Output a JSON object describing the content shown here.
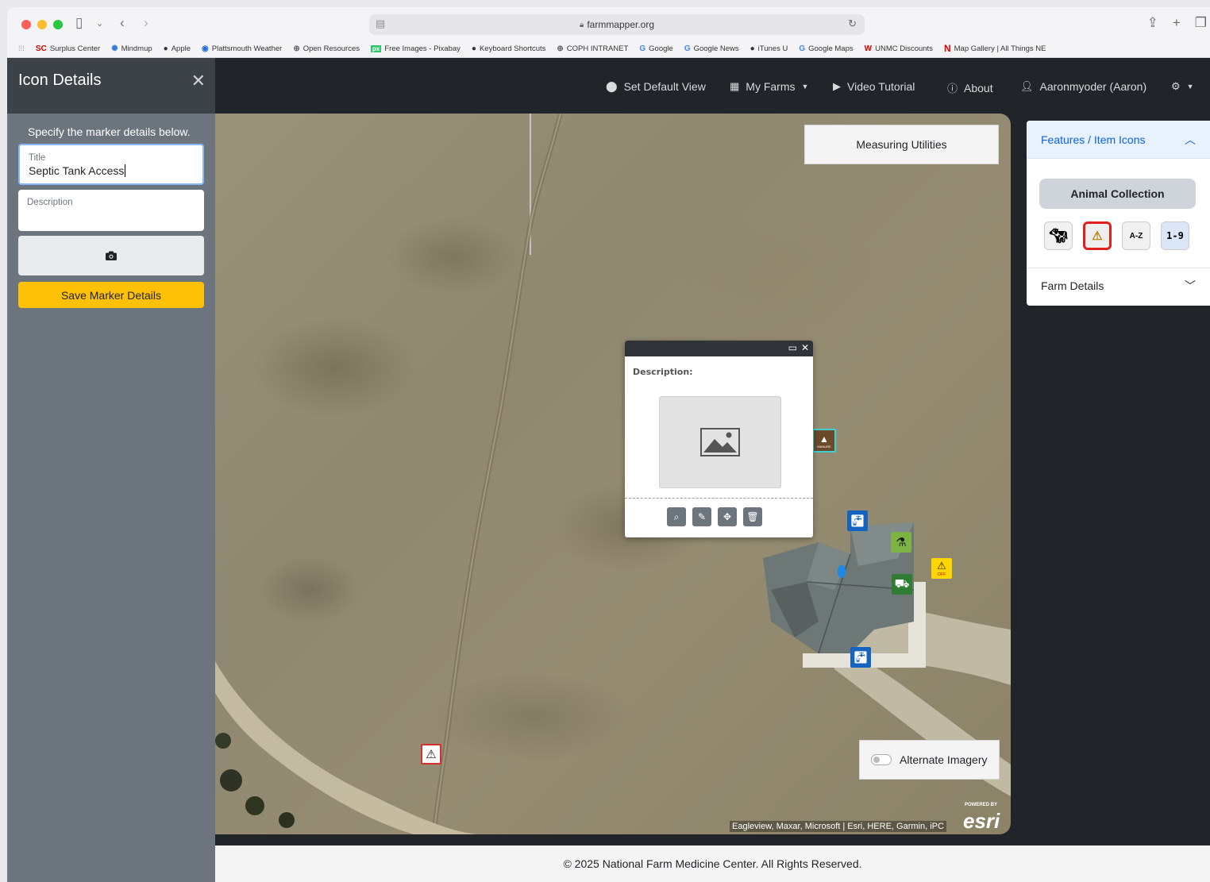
{
  "browser": {
    "url": "farmmapper.org",
    "bookmarks": [
      {
        "label": "Surplus Center",
        "icon": "sc-logo"
      },
      {
        "label": "Mindmup",
        "icon": "mindmup-icon"
      },
      {
        "label": "Apple",
        "icon": "apple-icon"
      },
      {
        "label": "Plattsmouth Weather",
        "icon": "weather-icon"
      },
      {
        "label": "Open Resources",
        "icon": "globe-icon"
      },
      {
        "label": "Free Images - Pixabay",
        "icon": "pixabay-icon"
      },
      {
        "label": "Keyboard Shortcuts",
        "icon": "apple-icon"
      },
      {
        "label": "COPH INTRANET",
        "icon": "globe-icon"
      },
      {
        "label": "Google",
        "icon": "google-icon"
      },
      {
        "label": "Google News",
        "icon": "google-icon"
      },
      {
        "label": "iTunes U",
        "icon": "apple-icon"
      },
      {
        "label": "Google Maps",
        "icon": "google-icon"
      },
      {
        "label": "UNMC Discounts",
        "icon": "unmc-icon"
      },
      {
        "label": "Map Gallery | All Things NE",
        "icon": "nebraska-icon"
      }
    ]
  },
  "left_panel": {
    "title": "Icon Details",
    "subtitle": "Specify the marker details below.",
    "title_field": {
      "label": "Title",
      "value": "Septic Tank Access"
    },
    "description_field": {
      "label": "Description",
      "value": ""
    },
    "save_label": "Save Marker Details"
  },
  "nav": {
    "set_default_view": "Set Default View",
    "my_farms": "My Farms",
    "video_tutorial": "Video Tutorial",
    "about": "About",
    "user": "Aaronmyoder (Aaron)"
  },
  "map": {
    "measuring_utilities": "Measuring Utilities",
    "alternate_imagery": "Alternate Imagery",
    "attribution": "Eagleview, Maxar, Microsoft | Esri, HERE, Garmin, iPC",
    "esri_powered": "POWERED BY",
    "esri_logo": "esri",
    "manure_label": "MANURE",
    "off_label": "OFF",
    "popup": {
      "description_label": "Description:"
    }
  },
  "right_panel": {
    "features_header": "Features / Item Icons",
    "collection_button": "Animal Collection",
    "icon_buttons": [
      {
        "label": "",
        "icon": "animal-icon"
      },
      {
        "label": "",
        "icon": "hazard-icon"
      },
      {
        "label": "A-Z",
        "icon": "alpha-icon"
      },
      {
        "label": "1-9",
        "icon": "numeric-icon"
      }
    ],
    "farm_details": "Farm Details"
  },
  "footer": {
    "text": "© 2025 National Farm Medicine Center. All Rights Reserved."
  }
}
